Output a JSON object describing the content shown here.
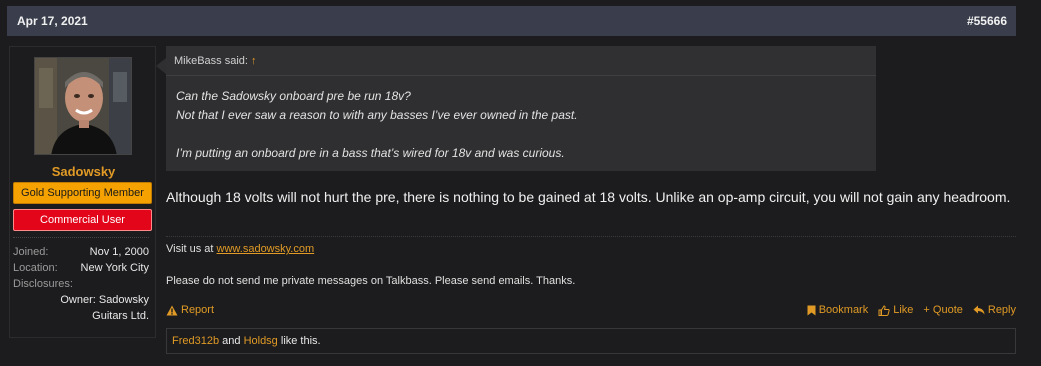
{
  "post": {
    "date": "Apr 17, 2021",
    "number": "#55666"
  },
  "user": {
    "name": "Sadowsky",
    "badges": {
      "gold": "Gold Supporting Member",
      "commercial": "Commercial User"
    },
    "info": {
      "joined_label": "Joined:",
      "joined_value": "Nov 1, 2000",
      "location_label": "Location:",
      "location_value": "New York City",
      "disclosures_label": "Disclosures:",
      "disclosures_value_1": "Owner: Sadowsky",
      "disclosures_value_2": "Guitars Ltd."
    }
  },
  "quote": {
    "author": "MikeBass said:",
    "arrow": "↑",
    "line1": "Can the Sadowsky onboard pre be run 18v?",
    "line2": "Not that I ever saw a reason to with any basses I’ve ever owned in the past.",
    "line3": "I’m putting an onboard pre in a bass that’s wired for 18v and was curious."
  },
  "body": {
    "text": "Although 18 volts will not hurt the pre, there is nothing to be gained at 18 volts. Unlike an op-amp circuit, you will not gain any headroom."
  },
  "signature": {
    "visit_prefix": "Visit us at ",
    "link": "www.sadowsky.com",
    "notice": "Please do not send me private messages on Talkbass. Please send emails. Thanks."
  },
  "actions": {
    "report": "Report",
    "bookmark": "Bookmark",
    "like": "Like",
    "quote": "+ Quote",
    "reply": "Reply"
  },
  "likes": {
    "user1": "Fred312b",
    "and": " and ",
    "user2": "Holdsg",
    "suffix": " like this."
  },
  "colors": {
    "accent": "#e09a25",
    "header_bg": "#3a3e4c",
    "gold_badge": "#f5a200",
    "commercial_badge": "#e3061b"
  }
}
